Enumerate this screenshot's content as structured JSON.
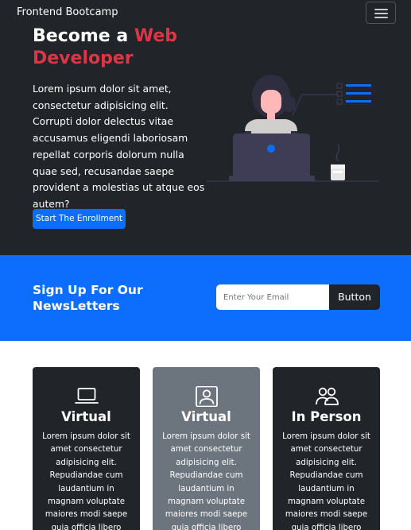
{
  "navbar": {
    "brand": "Frontend Bootcamp",
    "toggler_icon": "hamburger-menu-icon"
  },
  "hero": {
    "title_prefix": "Become a ",
    "title_accent": "Web",
    "title_second_line": "Developer",
    "lead": "Lorem ipsum dolor sit amet, consectetur adipisicing elit. Corrupti dolor delectus vitae accusamus eligendi laboriosam repellat corporis dolorum nulla quae sed, recusandae saepe provident a molestias ut atque eos autem?",
    "button_label": "Start The Enrollment",
    "illustration": "person-at-laptop-illustration"
  },
  "newsletter": {
    "title": "Sign Up For Our NewsLetters",
    "input_placeholder": "Enter Your Email",
    "input_value": "",
    "button_label": "Button"
  },
  "cards": [
    {
      "icon": "laptop-icon",
      "title": "Virtual",
      "text": "Lorem ipsum dolor sit amet consectetur adipisicing elit. Repudiandae cum laudantium in magnam voluptate maiores modi saepe quia officia libero"
    },
    {
      "icon": "person-badge-icon",
      "title": "Virtual",
      "text": "Lorem ipsum dolor sit amet consectetur adipisicing elit. Repudiandae cum laudantium in magnam voluptate maiores modi saepe quia officia libero"
    },
    {
      "icon": "people-icon",
      "title": "In Person",
      "text": "Lorem ipsum dolor sit amet consectetur adipisicing elit. Repudiandae cum laudantium in magnam voluptate maiores modi saepe quia officia libero"
    }
  ],
  "colors": {
    "dark": "#212529",
    "primary": "#0d6efd",
    "accent_red": "#dc3545",
    "card_gray": "#6c757d"
  }
}
